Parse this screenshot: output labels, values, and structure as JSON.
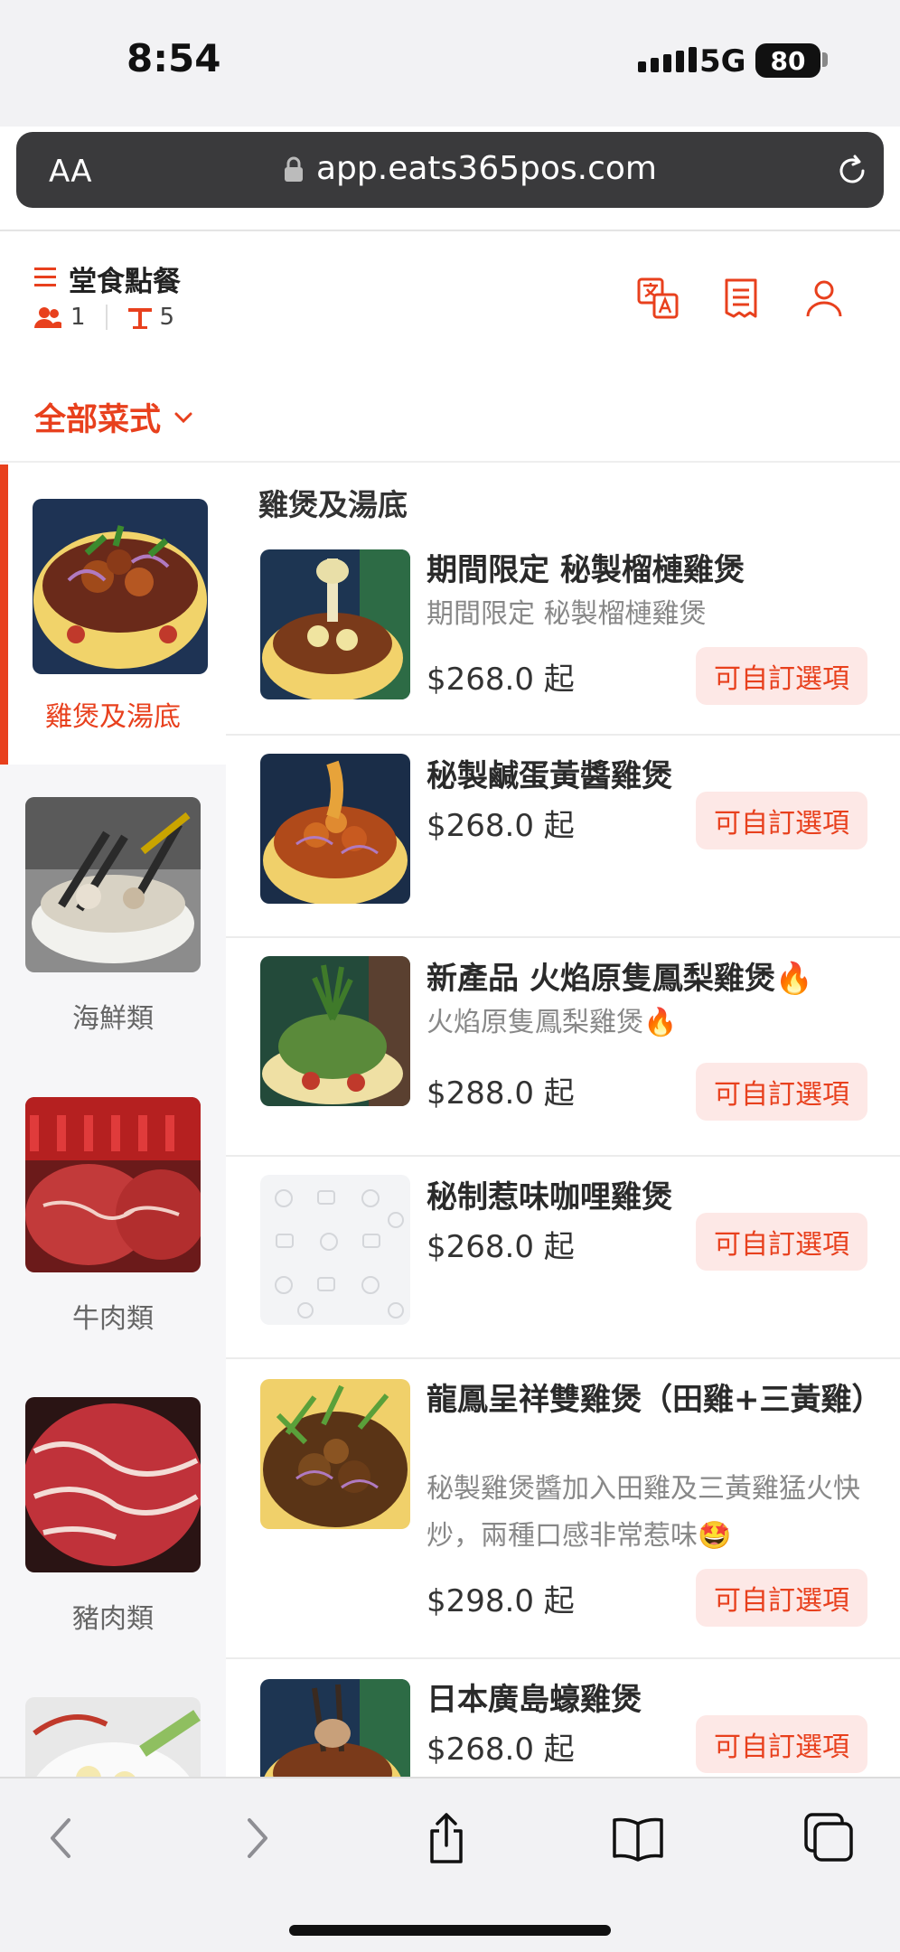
{
  "status_bar": {
    "time": "8:54",
    "network": "5G",
    "battery": "80"
  },
  "browser": {
    "text_size_label": "AA",
    "url": "app.eats365pos.com"
  },
  "header": {
    "title": "堂食點餐",
    "guest_count": "1",
    "table_number": "5",
    "icons": [
      "translate-icon",
      "order-list-icon",
      "account-icon"
    ]
  },
  "category_filter": {
    "label": "全部菜式"
  },
  "sidebar": {
    "items": [
      {
        "label": "雞煲及湯底",
        "active": true
      },
      {
        "label": "海鮮類",
        "active": false
      },
      {
        "label": "牛肉類",
        "active": false
      },
      {
        "label": "豬肉類",
        "active": false
      },
      {
        "label": "",
        "active": false
      }
    ]
  },
  "menu": {
    "section_title": "雞煲及湯底",
    "items": [
      {
        "name": "期間限定 秘製榴槤雞煲",
        "desc": "期間限定 秘製榴槤雞煲",
        "price": "$268.0 起",
        "badge": "可自訂選項"
      },
      {
        "name": "秘製鹹蛋黃醬雞煲",
        "desc": "",
        "price": "$268.0 起",
        "badge": "可自訂選項"
      },
      {
        "name": "新產品 火焰原隻鳳梨雞煲🔥",
        "desc": "火焰原隻鳳梨雞煲🔥",
        "price": "$288.0 起",
        "badge": "可自訂選項"
      },
      {
        "name": "秘制惹味咖哩雞煲",
        "desc": "",
        "price": "$268.0 起",
        "badge": "可自訂選項"
      },
      {
        "name": "龍鳳呈祥雙雞煲（田雞+三黃雞）",
        "desc": "秘製雞煲醬加入田雞及三黃雞猛火快炒，兩種口感非常惹味🤩",
        "price": "$298.0 起",
        "badge": "可自訂選項"
      },
      {
        "name": "日本廣島蠔雞煲",
        "desc": "",
        "price": "$268.0 起",
        "badge": "可自訂選項"
      }
    ]
  },
  "toolbar": {
    "icons": [
      "back-icon",
      "forward-icon",
      "share-icon",
      "bookmarks-icon",
      "tabs-icon"
    ]
  },
  "colors": {
    "accent": "#e8401d",
    "badge_bg": "#fde8e6"
  }
}
